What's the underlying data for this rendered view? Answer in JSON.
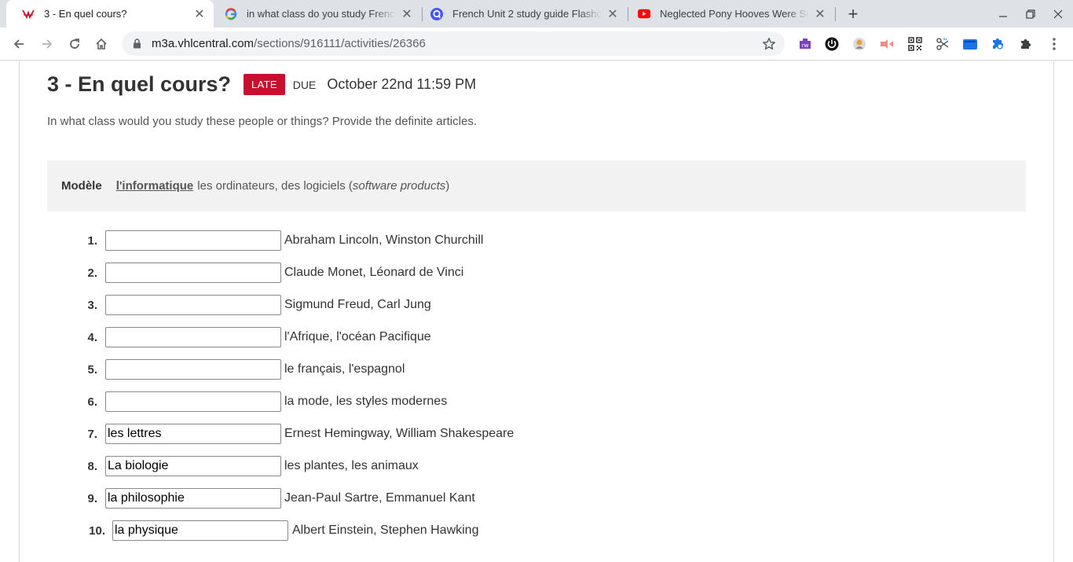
{
  "browser": {
    "tabs": [
      {
        "title": "3 - En quel cours?",
        "favicon": "vhl-icon",
        "active": true
      },
      {
        "title": "in what class do you study French",
        "favicon": "google-icon",
        "active": false
      },
      {
        "title": "French Unit 2 study guide Flashcards",
        "favicon": "quizlet-icon",
        "active": false
      },
      {
        "title": "Neglected Pony Hooves Were So",
        "favicon": "youtube-icon",
        "active": false
      }
    ],
    "url_host": "m3a.vhlcentral.com",
    "url_path": "/sections/916111/activities/26366"
  },
  "activity": {
    "title": "3 - En quel cours?",
    "status_badge": "LATE",
    "due_label": "DUE",
    "due_date": "October 22nd 11:59 PM",
    "instructions": "In what class would you study these people or things? Provide the definite articles.",
    "model": {
      "label": "Modèle",
      "answer": "l'informatique",
      "clue_prefix": "les ordinateurs, des logiciels (",
      "clue_italic": "software products",
      "clue_suffix": ")"
    },
    "questions": [
      {
        "number": "1.",
        "value": "",
        "clue": "Abraham Lincoln, Winston Churchill"
      },
      {
        "number": "2.",
        "value": "",
        "clue": "Claude Monet, Léonard de Vinci"
      },
      {
        "number": "3.",
        "value": "",
        "clue": "Sigmund Freud, Carl Jung"
      },
      {
        "number": "4.",
        "value": "",
        "clue": "l'Afrique, l'océan Pacifique"
      },
      {
        "number": "5.",
        "value": "",
        "clue": "le français, l'espagnol"
      },
      {
        "number": "6.",
        "value": "",
        "clue": "la mode, les styles modernes"
      },
      {
        "number": "7.",
        "value": "les lettres",
        "clue": "Ernest Hemingway, William Shakespeare"
      },
      {
        "number": "8.",
        "value": "La biologie",
        "clue": "les plantes, les animaux"
      },
      {
        "number": "9.",
        "value": "la philosophie",
        "clue": "Jean-Paul Sartre, Emmanuel Kant"
      },
      {
        "number": "10.",
        "value": "la physique",
        "clue": "Albert Einstein, Stephen Hawking"
      }
    ]
  },
  "colors": {
    "late_badge": "#c8102e",
    "tab_strip": "#dee1e6",
    "model_box": "#f2f2f2"
  }
}
